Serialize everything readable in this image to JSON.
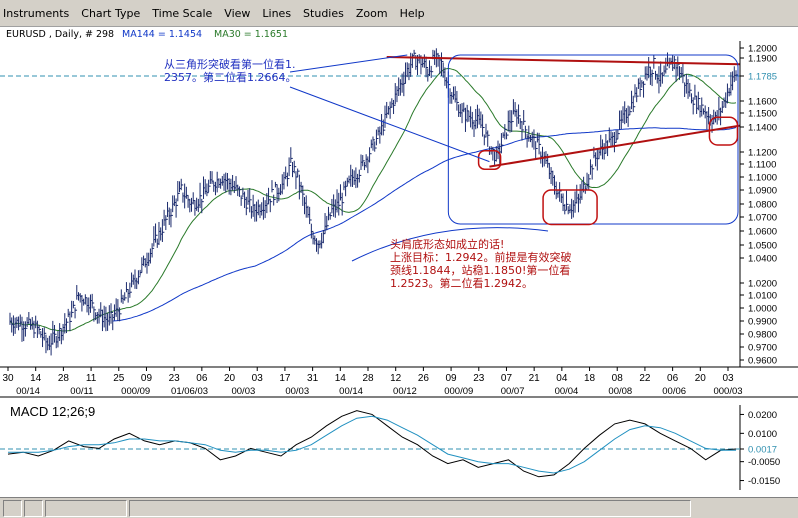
{
  "menu": [
    "Instruments",
    "Chart Type",
    "Time Scale",
    "View",
    "Lines",
    "Studies",
    "Zoom",
    "Help"
  ],
  "header": {
    "symbol": "EURUSD , Daily, # 298",
    "ma144": "MA144 = 1.1454",
    "ma30": "MA30 = 1.1651"
  },
  "annotations": {
    "triangle_note": "从三角形突破看第一位看1.\n2357。第二位看1.2664。",
    "hs_note": "头肩底形态如成立的话!\n上涨目标：1.2942。前提是有效突破\n颈线1.1844，站稳1.1850!第一位看\n1.2523。第二位看1.2942。"
  },
  "colors": {
    "price_bars": "#1a2a6c",
    "ma144": "#1038c8",
    "ma30": "#2a7a2a",
    "trendline": "#b01010",
    "highlight_circle": "#c01010",
    "box": "#1038c8",
    "current_price_line": "#3090b0",
    "macd": "#000000",
    "macd_signal": "#2090c0"
  },
  "chart_data": [
    {
      "type": "candlestick",
      "title": "EURUSD , Daily, # 298",
      "ylim": [
        0.955,
        1.205
      ],
      "y_ticks": [
        "1.2000",
        "1.1900",
        "1.1785",
        "1.1600",
        "1.1500",
        "1.1400",
        "1.1200",
        "1.1100",
        "1.1000",
        "1.0900",
        "1.0800",
        "1.0700",
        "1.0600",
        "1.0500",
        "1.0400",
        "1.0200",
        "1.0100",
        "1.0000",
        "0.9900",
        "0.9800",
        "0.9700",
        "0.9600"
      ],
      "current_price": 1.1785,
      "x_day_labels": [
        "30",
        "14",
        "28",
        "11",
        "25",
        "09",
        "23",
        "06",
        "20",
        "03",
        "17",
        "31",
        "14",
        "28",
        "12",
        "26",
        "09",
        "23",
        "07",
        "21",
        "04",
        "18",
        "08",
        "22",
        "06",
        "20",
        "03"
      ],
      "x_month_labels": [
        "00/14",
        "00/11",
        "000/09",
        "01/06/03",
        "00/03",
        "00/03",
        "00/14",
        "00/12",
        "000/09",
        "00/07",
        "00/04",
        "00/08",
        "00/06",
        "000/03"
      ],
      "close_path": [
        [
          0,
          0.99
        ],
        [
          4,
          0.988
        ],
        [
          8,
          0.984
        ],
        [
          11,
          0.972
        ],
        [
          14,
          0.98
        ],
        [
          18,
          0.995
        ],
        [
          20,
          1.01
        ],
        [
          23,
          1.005
        ],
        [
          26,
          0.995
        ],
        [
          29,
          0.99
        ],
        [
          32,
          1.0
        ],
        [
          35,
          1.015
        ],
        [
          38,
          1.03
        ],
        [
          41,
          1.045
        ],
        [
          44,
          1.06
        ],
        [
          47,
          1.075
        ],
        [
          50,
          1.09
        ],
        [
          53,
          1.08
        ],
        [
          56,
          1.085
        ],
        [
          59,
          1.095
        ],
        [
          62,
          1.1
        ],
        [
          65,
          1.093
        ],
        [
          68,
          1.085
        ],
        [
          71,
          1.075
        ],
        [
          74,
          1.08
        ],
        [
          77,
          1.088
        ],
        [
          80,
          1.095
        ],
        [
          82,
          1.11
        ],
        [
          84,
          1.1
        ],
        [
          86,
          1.08
        ],
        [
          88,
          1.06
        ],
        [
          90,
          1.052
        ],
        [
          92,
          1.06
        ],
        [
          94,
          1.075
        ],
        [
          96,
          1.08
        ],
        [
          98,
          1.09
        ],
        [
          100,
          1.1
        ],
        [
          102,
          1.105
        ],
        [
          104,
          1.115
        ],
        [
          106,
          1.125
        ],
        [
          108,
          1.135
        ],
        [
          110,
          1.148
        ],
        [
          112,
          1.16
        ],
        [
          114,
          1.172
        ],
        [
          116,
          1.182
        ],
        [
          118,
          1.19
        ],
        [
          120,
          1.188
        ],
        [
          122,
          1.182
        ],
        [
          124,
          1.19
        ],
        [
          126,
          1.186
        ],
        [
          128,
          1.172
        ],
        [
          130,
          1.16
        ],
        [
          132,
          1.15
        ],
        [
          134,
          1.148
        ],
        [
          136,
          1.145
        ],
        [
          138,
          1.14
        ],
        [
          140,
          1.125
        ],
        [
          142,
          1.115
        ],
        [
          144,
          1.13
        ],
        [
          146,
          1.145
        ],
        [
          148,
          1.15
        ],
        [
          150,
          1.14
        ],
        [
          152,
          1.132
        ],
        [
          154,
          1.125
        ],
        [
          156,
          1.115
        ],
        [
          158,
          1.1
        ],
        [
          160,
          1.088
        ],
        [
          162,
          1.08
        ],
        [
          164,
          1.078
        ],
        [
          166,
          1.082
        ],
        [
          168,
          1.095
        ],
        [
          170,
          1.11
        ],
        [
          172,
          1.12
        ],
        [
          174,
          1.125
        ],
        [
          176,
          1.13
        ],
        [
          178,
          1.14
        ],
        [
          180,
          1.15
        ],
        [
          182,
          1.16
        ],
        [
          184,
          1.172
        ],
        [
          186,
          1.182
        ],
        [
          188,
          1.185
        ],
        [
          190,
          1.175
        ],
        [
          192,
          1.182
        ],
        [
          194,
          1.188
        ],
        [
          196,
          1.18
        ],
        [
          198,
          1.168
        ],
        [
          200,
          1.16
        ],
        [
          202,
          1.155
        ],
        [
          204,
          1.148
        ],
        [
          206,
          1.145
        ],
        [
          208,
          1.155
        ],
        [
          210,
          1.17
        ],
        [
          212,
          1.18
        ]
      ],
      "overlays": [
        "MA144",
        "MA30"
      ],
      "shapes": {
        "trendline_top": "from 1.191 near 12 to 1.186 at right edge",
        "trendline_neck": "from 1.108 near 21 to 1.141 at right edge"
      }
    },
    {
      "type": "line",
      "title": "MACD 12;26;9",
      "ylim": [
        -0.02,
        0.025
      ],
      "y_ticks": [
        "0.0200",
        "0.0100",
        "0.0017",
        "-0.0050",
        "-0.0150"
      ],
      "current_value": 0.0017,
      "series": [
        {
          "values": [
            -0.001,
            0.0,
            -0.002,
            0.001,
            0.006,
            0.003,
            0.002,
            0.007,
            0.01,
            0.006,
            0.004,
            0.006,
            0.005,
            0.002,
            -0.004,
            -0.002,
            0.002,
            0.0,
            -0.002,
            0.004,
            0.008,
            0.014,
            0.019,
            0.022,
            0.02,
            0.014,
            0.008,
            0.004,
            -0.002,
            -0.006,
            -0.004,
            -0.008,
            -0.006,
            -0.004,
            -0.01,
            -0.013,
            -0.012,
            -0.006,
            0.002,
            0.009,
            0.015,
            0.017,
            0.015,
            0.01,
            0.006,
            0.002,
            -0.004,
            0.001,
            0.0017
          ]
        },
        {
          "values": [
            0.0,
            0.0,
            0.0,
            0.001,
            0.003,
            0.004,
            0.004,
            0.005,
            0.007,
            0.007,
            0.006,
            0.006,
            0.005,
            0.004,
            0.001,
            0.0,
            0.001,
            0.001,
            0.0,
            0.001,
            0.004,
            0.009,
            0.014,
            0.018,
            0.019,
            0.017,
            0.013,
            0.009,
            0.004,
            -0.001,
            -0.003,
            -0.005,
            -0.006,
            -0.006,
            -0.008,
            -0.01,
            -0.011,
            -0.009,
            -0.005,
            0.001,
            0.007,
            0.012,
            0.014,
            0.013,
            0.01,
            0.006,
            0.002,
            0.001,
            0.001
          ]
        }
      ]
    }
  ]
}
